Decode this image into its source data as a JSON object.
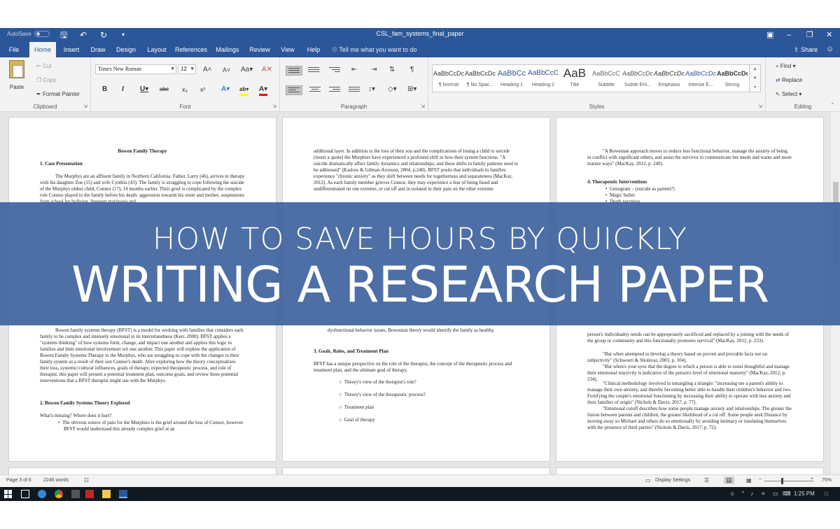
{
  "window": {
    "autosave_label": "AutoSave",
    "autosave_state": "Off",
    "title": "CSL_fam_systems_final_paper",
    "save_icon": "save-icon",
    "undo_icon": "undo-icon",
    "redo_icon": "redo-icon",
    "customize_icon": "chevron-down-icon"
  },
  "tabs": [
    "File",
    "Home",
    "Insert",
    "Draw",
    "Design",
    "Layout",
    "References",
    "Mailings",
    "Review",
    "View",
    "Help"
  ],
  "active_tab": "Home",
  "tell_me": "Tell me what you want to do",
  "share": "Share",
  "ribbon": {
    "clipboard": {
      "label": "Clipboard",
      "paste": "Paste",
      "cut": "Cut",
      "copy": "Copy",
      "format_painter": "Format Painter"
    },
    "font": {
      "label": "Font",
      "font_name": "Times New Roman",
      "font_size": "12"
    },
    "paragraph": {
      "label": "Paragraph"
    },
    "styles": {
      "label": "Styles",
      "items": [
        {
          "sample": "AaBbCcDc",
          "name": "¶ Normal"
        },
        {
          "sample": "AaBbCcDc",
          "name": "¶ No Spac..."
        },
        {
          "sample": "AaBbCc",
          "name": "Heading 1"
        },
        {
          "sample": "AaBbCcC",
          "name": "Heading 2"
        },
        {
          "sample": "AaB",
          "name": "Title"
        },
        {
          "sample": "AaBbCcC",
          "name": "Subtitle"
        },
        {
          "sample": "AaBbCcDc",
          "name": "Subtle Em..."
        },
        {
          "sample": "AaBbCcDc",
          "name": "Emphasis"
        },
        {
          "sample": "AaBbCcDc",
          "name": "Intense E..."
        },
        {
          "sample": "AaBbCcDc",
          "name": "Strong"
        }
      ]
    },
    "editing": {
      "label": "Editing",
      "find": "Find",
      "replace": "Replace",
      "select": "Select"
    }
  },
  "pages": {
    "p1": {
      "title": "Bowen Family Therapy",
      "h1": "1. Case Presentation",
      "para1": "The Murphys are an affluent family in Northern California. Father, Larry (46), arrives in therapy with his daughter Zoe (15) and wife Cynthia (43). The family is struggling to cope following the suicide of the Murphys oldest child, Connor (17), 14 months earlier. Their grief is complicated by the complex role Connor played in the family before his death: aggression towards his sister and mother, suspensions from school for bullying, frequent marijuana and",
      "para2": "Bowen family systems therapy (BFST) is a model for working with families that considers each family to be complex and intensely emotional in its interrelatedness (Kerr, 2000). BFST applies a \"systems thinking\" of how systems form, change, and impact one another and applies this logic to families and their emotional involvement wit one another. This paper will explore the application of Bowen Family Systems Therapy to the Murphys, who are struggling to cope with the changes to their family system as a result of their son Connor's death. After exploring how the theory conceptualizes their loss, systemic/cultural influences, goals of therapy, expected therapeutic process, and role of therapist, this paper will present a potential treatment plan, outcome goals, and review three potential interventions that a BFST therapist might use with the Murphys.",
      "h2": "2. Bowen Family Systems Theory Explored",
      "q": "What's missing? Where does it hurt?",
      "bullet": "The obvious source of pain for the Murphies is the grief around the loss of Connor, however BFST would understand this already complex grief at an"
    },
    "p2": {
      "para1": "additional layer. In addition to the loss of their son and the complications of losing a child to suicide (insert a quote) the Murphies have experienced a profound shift in how their system functions. \"A suicide dramatically affect family dynamics and relationships, and these shifts in family patterns need to be addressed\" (Kaslow & Gilman-Aronson, 2004, p.240). BFST posits that individuals in families experience \"chronic anxiety\" as they shift between needs for togetherness and separateness (MacKay, 2012). As each family member grieves Connor, they may experience a fear of being fused and undifferentiated on one extreme, or cut off and in isolated in their pain on the other extreme.",
      "para2": "dysfunctional behavior issues, Bowenian theory would identify the family as healthy.",
      "h3": "3. Goals, Roles, and Treatment Plan",
      "para3": "BFST has a unique perspective on the role of the therapist, the concept of the therapeutic process and treatment plan, and the ultimate goal of therapy.",
      "items": [
        "Theory's view of the therapist's role?",
        "Theory's view of the therapeutic process?",
        "Treatment plan",
        "Goal of therapy"
      ]
    },
    "p3": {
      "para1": "\"A Bowenian approach moves to reduce less functional behavior, manage the anxiety of being in conflict with significant others, and assist the survivor to communicate her needs and wants and more mature ways\" (MacKay, 2012, p. 240).",
      "h4": "4. Therapeutic Interventions",
      "bullets": [
        "Genogram – (suicide as pattern?)",
        "Magic bullet",
        "Death narrative"
      ],
      "para2": "person's individuality needs can be appropriately sacrificed and replaced by a joining with the needs of the group or community and this functionally promotes survival\" (MacKay, 2012, p. 233).",
      "para3": "\"But when attempted to develop a theory based on proven and provable facts not on subjectivity\" (Schwoeri & Sholevar, 2003, p. 104).",
      "para4": "\"But when's your eyes that the degree to which a person is able to resist thoughtful and manage their emotional reactivity is indicative of the person's level of emotional maturity\" (MacKay, 2012, p. 234).",
      "para5": "\"Clinical methodology involved in untangling a triangle: \"increasing me a parent's ability to manage their own anxiety, and thereby becoming better able to handle their children's behavior and two. Fortifying the couple's emotional functioning by increasing their ability to operate with less anxiety and their families of origin\" (Nichols & Davis, 2017, p. 77).",
      "para6": "\"Emotional cutoff describes how some people manage anxiety and relationships. The greater the fusion between parents and children, the greater likelihood of a cut off. Some people seek Distance by moving away so Michael and others do so emotionally by avoiding intimacy or insulating themselves with the presence of third parties\" (Nichols & Davis, 2017, p. 72)."
    }
  },
  "banner": {
    "line1": "HOW TO SAVE HOURS BY QUICKLY",
    "line2": "WRITING A RESEARCH PAPER"
  },
  "status": {
    "page": "Page 3 of 6",
    "words": "2246 words",
    "display_settings": "Display Settings",
    "zoom": "75%"
  },
  "taskbar": {
    "time": "1:25 PM"
  }
}
